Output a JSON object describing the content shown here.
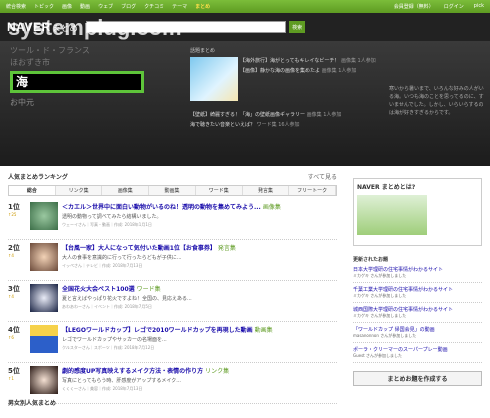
{
  "watermark": "systemplug.com",
  "topnav": {
    "items": [
      "統合検索",
      "トピック",
      "画像",
      "動画",
      "ウェブ",
      "ブログ",
      "クチコミ",
      "テーマ",
      "まとめ"
    ],
    "right": [
      "会員登録（無料）",
      "ログイン",
      "pick"
    ]
  },
  "header": {
    "logo": "NAVER",
    "logo_suffix": "まとめ",
    "search_btn": "検索"
  },
  "hero": {
    "words_top": [
      "ツール・ド・フランス",
      "ほおずき市"
    ],
    "selected": "海",
    "words_bottom": [
      "お中元"
    ],
    "wadai_label": "話題まとめ",
    "wadai_items": [
      {
        "title": "【海外旅行】海がとってもキレイなビーチ！",
        "meta": "画像集 1人参加"
      },
      {
        "title": "【画像】静かな海の画像を集めたよ",
        "meta": "画像集 1人参加"
      },
      {
        "title": "【壁紙】綺麗すぎる！「海」の壁紙画像ギャラリー",
        "meta": "画像集 1人参加"
      },
      {
        "title": "海で聴きたい音楽といえば？",
        "meta": "ワード集 16人参加"
      }
    ],
    "right_text": "寒いから暑いまで、いろんな好みの人がいる海。いつも海のことを思ってるのに、すいませんでした。しかし、いらいらするのは海が好きすぎるからです。"
  },
  "ranking": {
    "title": "人気まとめランキング",
    "more": "すべて見る",
    "tabs": [
      "総合",
      "リンク集",
      "画像集",
      "動画集",
      "ワード集",
      "発言集",
      "フリートーク"
    ],
    "rows": [
      {
        "rank": "1位",
        "up": "↑25",
        "title": "＜カエル＞世界中に面白い動物がいるのね！透明の動物を集めてみよう...",
        "cat": "画像集",
        "desc": "透明の動物って調べてみたら結構いました。",
        "meta": "ウェーイさん｜写真・動画｜作成: 2018年1月1日"
      },
      {
        "rank": "2位",
        "up": "↑4",
        "title": "【台風一家】大人になって気付いた動画1位【お食事券】",
        "cat": "発言集",
        "desc": "大人の食事を意識的に行って行ったらどもが子供に...",
        "meta": "イッペさん｜テレビ｜作成: 2018年7月13日"
      },
      {
        "rank": "3位",
        "up": "↑4",
        "title": "全国花火大会ベスト100選",
        "cat": "ワード集",
        "desc": "夏と言えばやっぱり花火ですよね！全国の、見応えある...",
        "meta": "あわあわーさん｜イベント｜作成: 2018年7月5日"
      },
      {
        "rank": "4位",
        "up": "↑6",
        "title": "【LEGOワールドカップ】レゴで2010ワールドカップを再現した動画",
        "cat": "動画集",
        "desc": "レゴでワールドカップやサッカーの名場面を...",
        "meta": "クルスターさん｜スポーツ｜作成: 2018年7月12日"
      },
      {
        "rank": "5位",
        "up": "↑1",
        "title": "劇的感度UP写真映えするメイク方法・表情の作り方",
        "cat": "リンク集",
        "desc": "写真にとってもらう時、肝感度がアップするメイク...",
        "meta": "くくく～さん｜美容｜作成: 2018年7月13日"
      }
    ]
  },
  "sidebar": {
    "promo_title": "NAVER まとめとは?",
    "updated_title": "更新されたお題",
    "updates": [
      {
        "title": "日本大学理研の住宅事情がわかるサイト",
        "meta": "ミカゲキ さんが参加しました"
      },
      {
        "title": "千葉工業大学理研の住宅事情がわかるサイト",
        "meta": "ミカゲキ さんが参加しました"
      },
      {
        "title": "城西国際大学理研の住宅事情がわかるサイト",
        "meta": "ミカゲキ さんが参加しました"
      },
      {
        "title": "「ワールドカップ 帰国会見」の動画",
        "meta": "masanonnon さんが参加しました"
      },
      {
        "title": "ポーラ・クリーマーのスーパープレー動画",
        "meta": "Guest さんが参加しました"
      }
    ],
    "create_btn": "まとめお題を作成する"
  },
  "bottom_title": "男女別人気まとめ"
}
